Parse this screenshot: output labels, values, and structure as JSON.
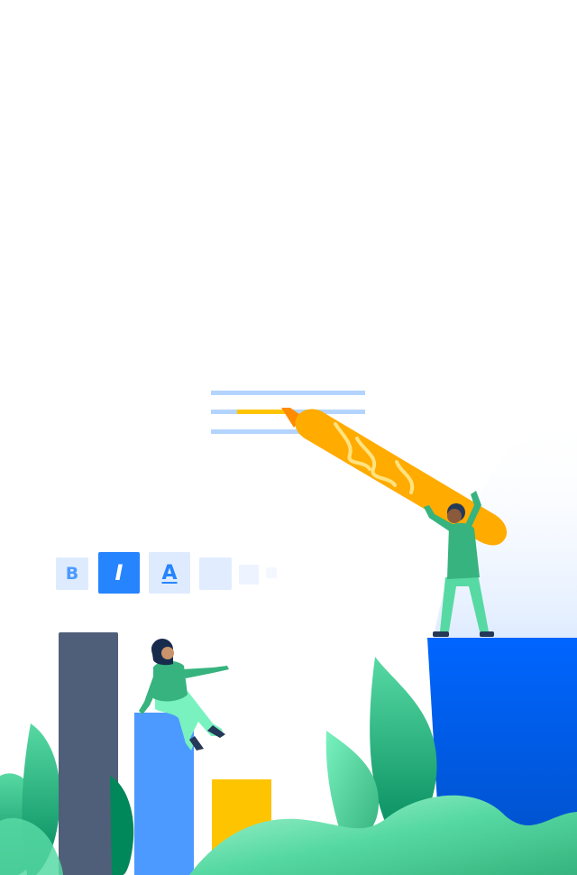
{
  "toolbar": {
    "bold_label": "B",
    "italic_label": "I",
    "underline_label": "A"
  },
  "colors": {
    "accent_blue": "#0065ff",
    "light_blue": "#deebff",
    "mid_blue": "#4c9aff",
    "navy_bar": "#505f79",
    "yellow": "#ffc400",
    "orange_pen": "#ffab00",
    "green": "#36b37e",
    "mint": "#57d9a3"
  },
  "icons": [
    "bold-icon",
    "italic-icon",
    "underline-icon",
    "highlighter-pen-icon"
  ]
}
